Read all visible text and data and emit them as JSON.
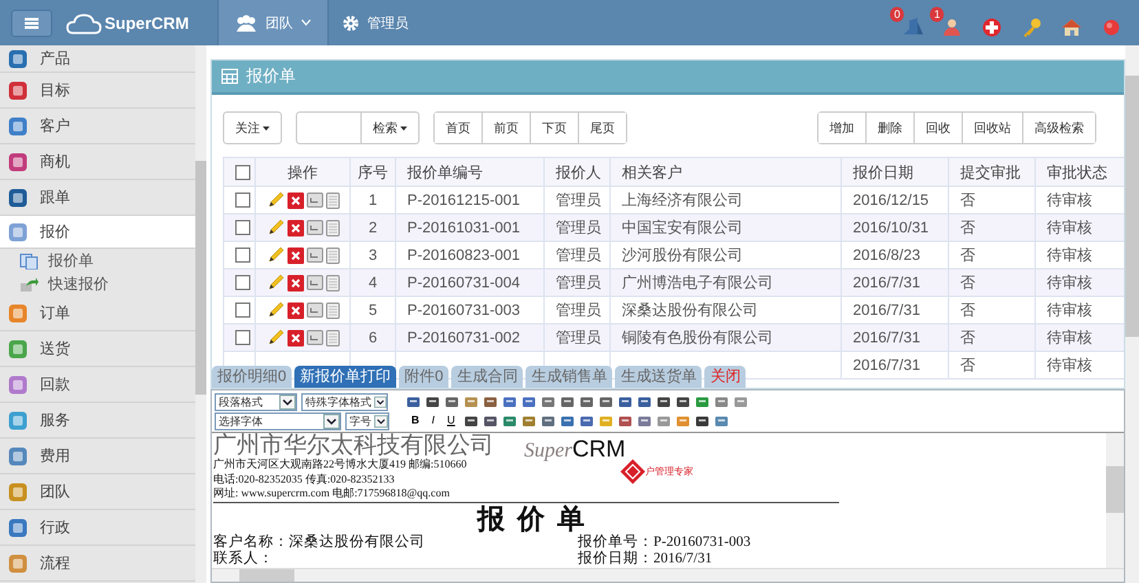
{
  "topbar": {
    "logo": "SuperCRM",
    "menus": [
      {
        "label": "团队",
        "dropdown": true,
        "selected": true
      },
      {
        "label": "管理员",
        "dropdown": false,
        "selected": false
      }
    ],
    "tools": [
      {
        "badge": "0"
      },
      {
        "badge": "1"
      }
    ]
  },
  "sidebar": {
    "items": [
      {
        "label": "产品",
        "selected": false
      },
      {
        "label": "目标",
        "selected": false
      },
      {
        "label": "客户",
        "selected": false
      },
      {
        "label": "商机",
        "selected": false
      },
      {
        "label": "跟单",
        "selected": false
      },
      {
        "label": "报价",
        "selected": true,
        "children": [
          {
            "label": "报价单"
          },
          {
            "label": "快速报价"
          }
        ]
      },
      {
        "label": "订单",
        "selected": false
      },
      {
        "label": "送货",
        "selected": false
      },
      {
        "label": "回款",
        "selected": false
      },
      {
        "label": "服务",
        "selected": false
      },
      {
        "label": "费用",
        "selected": false
      },
      {
        "label": "团队",
        "selected": false
      },
      {
        "label": "行政",
        "selected": false
      },
      {
        "label": "流程",
        "selected": false
      }
    ]
  },
  "panel": {
    "title": "报价单",
    "toolbar": {
      "follow": "关注",
      "search_button": "检索",
      "pager": [
        "首页",
        "前页",
        "下页",
        "尾页"
      ],
      "actions": [
        "增加",
        "删除",
        "回收",
        "回收站",
        "高级检索"
      ]
    },
    "table": {
      "all_checked": false,
      "action_column": "操作",
      "columns": [
        "序号",
        "报价单编号",
        "报价人",
        "相关客户",
        "报价日期",
        "提交审批",
        "审批状态"
      ],
      "rows": [
        {
          "checked": false,
          "cells": [
            "1",
            "P-20161215-001",
            "管理员",
            "上海经济有限公司",
            "2016/12/15",
            "否",
            "待审核"
          ]
        },
        {
          "checked": false,
          "cells": [
            "2",
            "P-20161031-001",
            "管理员",
            "中国宝安有限公司",
            "2016/10/31",
            "否",
            "待审核"
          ]
        },
        {
          "checked": false,
          "cells": [
            "3",
            "P-20160823-001",
            "管理员",
            "沙河股份有限公司",
            "2016/8/23",
            "否",
            "待审核"
          ]
        },
        {
          "checked": false,
          "cells": [
            "4",
            "P-20160731-004",
            "管理员",
            "广州博浩电子有限公司",
            "2016/7/31",
            "否",
            "待审核"
          ]
        },
        {
          "checked": false,
          "cells": [
            "5",
            "P-20160731-003",
            "管理员",
            "深桑达股份有限公司",
            "2016/7/31",
            "否",
            "待审核"
          ]
        },
        {
          "checked": false,
          "cells": [
            "6",
            "P-20160731-002",
            "管理员",
            "铜陵有色股份有限公司",
            "2016/7/31",
            "否",
            "待审核"
          ]
        },
        {
          "cells": [
            null,
            null,
            null,
            null,
            "2016/7/31",
            "否",
            "待审核"
          ]
        }
      ]
    }
  },
  "tabs": [
    {
      "label": "报价明细0",
      "selected": false,
      "kind": "tab"
    },
    {
      "label": "新报价单打印",
      "selected": true,
      "kind": "tab"
    },
    {
      "label": "附件0",
      "selected": false,
      "kind": "tab"
    },
    {
      "label": "生成合同",
      "selected": false,
      "kind": "tab"
    },
    {
      "label": "生成销售单",
      "selected": false,
      "kind": "tab"
    },
    {
      "label": "生成送货单",
      "selected": false,
      "kind": "tab"
    },
    {
      "label": "关闭",
      "selected": false,
      "kind": "close"
    }
  ],
  "editor": {
    "selects_row1": [
      "段落格式",
      "特殊字体格式"
    ],
    "selects_row2": [
      "选择字体",
      "字号"
    ],
    "format_buttons": [
      "B",
      "I",
      "U"
    ],
    "document": {
      "company": "广州市华尔太科技有限公司",
      "lines": [
        "广州市天河区大观南路22号博水大厦419 邮编:510660",
        "电话:020-82352035   传真:020-82352133",
        "网址: www.supercrm.com  电邮:717596818@qq.com"
      ],
      "logo_super": "Super",
      "logo_crm": "CRM",
      "slogan": "户管理专家",
      "title": "报 价 单",
      "fields": [
        {
          "left": "客户名称：深桑达股份有限公司",
          "right": "报价单号：P-20160731-003"
        },
        {
          "left": "联系人：",
          "right": "报价日期：2016/7/31"
        }
      ]
    }
  }
}
